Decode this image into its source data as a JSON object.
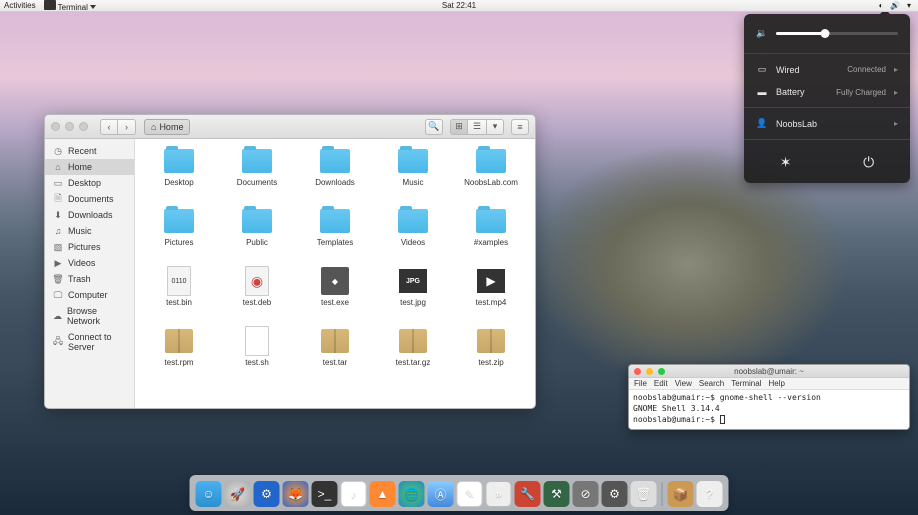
{
  "topbar": {
    "activities": "Activities",
    "app": "Terminal",
    "clock": "Sat 22:41"
  },
  "sysmenu": {
    "network_label": "Wired",
    "network_status": "Connected",
    "battery_label": "Battery",
    "battery_status": "Fully Charged",
    "user": "NoobsLab"
  },
  "fm": {
    "location": "Home",
    "sidebar": [
      {
        "icon": "clock",
        "label": "Recent"
      },
      {
        "icon": "home",
        "label": "Home",
        "active": true
      },
      {
        "icon": "desktop",
        "label": "Desktop"
      },
      {
        "icon": "doc",
        "label": "Documents"
      },
      {
        "icon": "down",
        "label": "Downloads"
      },
      {
        "icon": "music",
        "label": "Music"
      },
      {
        "icon": "pic",
        "label": "Pictures"
      },
      {
        "icon": "video",
        "label": "Videos"
      },
      {
        "icon": "trash",
        "label": "Trash"
      },
      {
        "icon": "computer",
        "label": "Computer"
      },
      {
        "icon": "network",
        "label": "Browse Network"
      },
      {
        "icon": "server",
        "label": "Connect to Server"
      }
    ],
    "files": [
      {
        "type": "folder",
        "name": "Desktop"
      },
      {
        "type": "folder",
        "name": "Documents"
      },
      {
        "type": "folder",
        "name": "Downloads"
      },
      {
        "type": "folder",
        "name": "Music"
      },
      {
        "type": "folder",
        "name": "NoobsLab.com"
      },
      {
        "type": "folder",
        "name": "Pictures"
      },
      {
        "type": "folder",
        "name": "Public"
      },
      {
        "type": "folder",
        "name": "Templates"
      },
      {
        "type": "folder",
        "name": "Videos"
      },
      {
        "type": "folder",
        "name": "#xamples"
      },
      {
        "type": "bin",
        "name": "test.bin"
      },
      {
        "type": "deb",
        "name": "test.deb"
      },
      {
        "type": "exe",
        "name": "test.exe"
      },
      {
        "type": "jpg",
        "name": "test.jpg"
      },
      {
        "type": "mp4",
        "name": "test.mp4"
      },
      {
        "type": "pkg",
        "name": "test.rpm"
      },
      {
        "type": "sh",
        "name": "test.sh"
      },
      {
        "type": "pkg",
        "name": "test.tar"
      },
      {
        "type": "pkg",
        "name": "test.tar.gz"
      },
      {
        "type": "pkg",
        "name": "test.zip"
      }
    ]
  },
  "terminal": {
    "title": "noobslab@umair: ~",
    "menu": [
      "File",
      "Edit",
      "View",
      "Search",
      "Terminal",
      "Help"
    ],
    "lines": [
      "noobslab@umair:~$ gnome-shell --version",
      "GNOME Shell 3.14.4",
      "noobslab@umair:~$ "
    ]
  },
  "dock": {
    "items": [
      "finder",
      "launch",
      "sys",
      "ff",
      "term",
      "music",
      "vlc",
      "globe",
      "store",
      "text",
      "chev",
      "tool",
      "tweak",
      "disk",
      "settings",
      "trash",
      "sep",
      "box",
      "help"
    ]
  }
}
